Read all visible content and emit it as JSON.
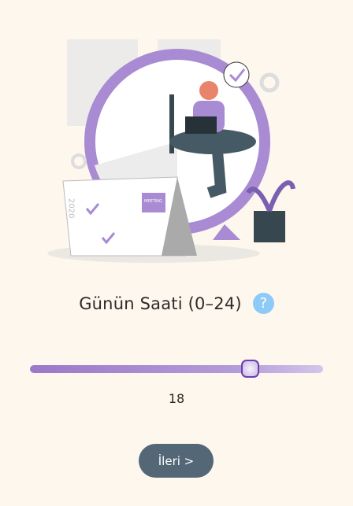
{
  "illustration": {
    "calendar_label": "MEETING",
    "calendar_year": "2020"
  },
  "question": {
    "title": "Günün Saati (0–24)",
    "help_icon": "?"
  },
  "slider": {
    "min": 0,
    "max": 24,
    "value": 18,
    "value_label": "18"
  },
  "next_button": {
    "label": "İleri >"
  },
  "colors": {
    "accent": "#9b78c9",
    "button": "#546776",
    "help": "#8ecaf7",
    "background": "#fef7ee"
  }
}
